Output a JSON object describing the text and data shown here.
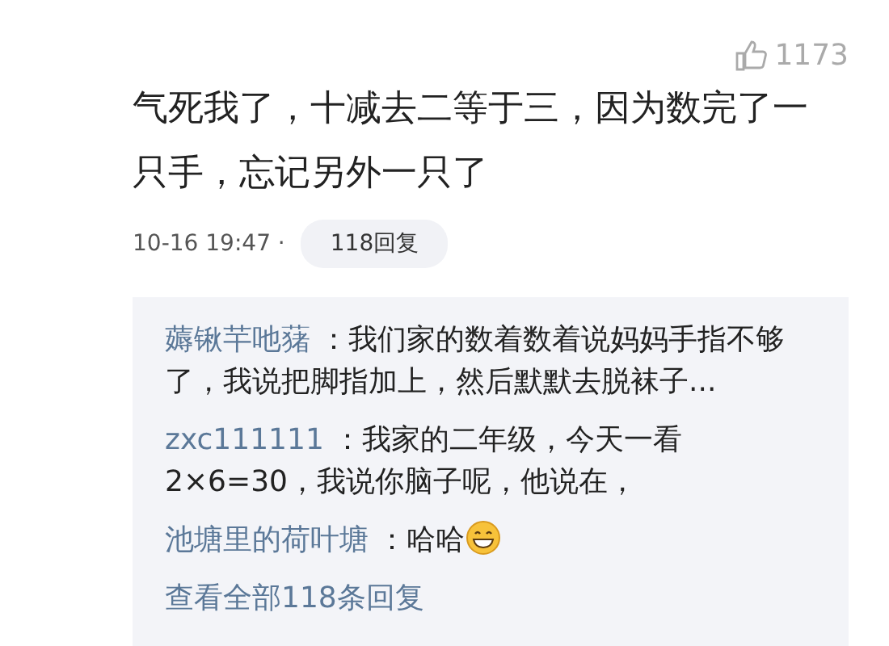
{
  "like": {
    "count": "1173"
  },
  "comment": {
    "text": "气死我了，十减去二等于三，因为数完了一只手，忘记另外一只了",
    "time": "10-16 19:47 ·",
    "reply_count": "118回复"
  },
  "replies": [
    {
      "author": "薅锹芉吔蕏",
      "text": " ：我们家的数着数着说妈妈手指不够了，我说把脚指加上，然后默默去脱袜子...",
      "emoji": false
    },
    {
      "author": "zxc111111",
      "text": " ：我家的二年级，今天一看2×6=30，我说你脑子呢，他说在，",
      "emoji": false
    },
    {
      "author": "池塘里的荷叶塘",
      "text": " ：哈哈",
      "emoji": true
    }
  ],
  "view_all": "查看全部118条回复"
}
